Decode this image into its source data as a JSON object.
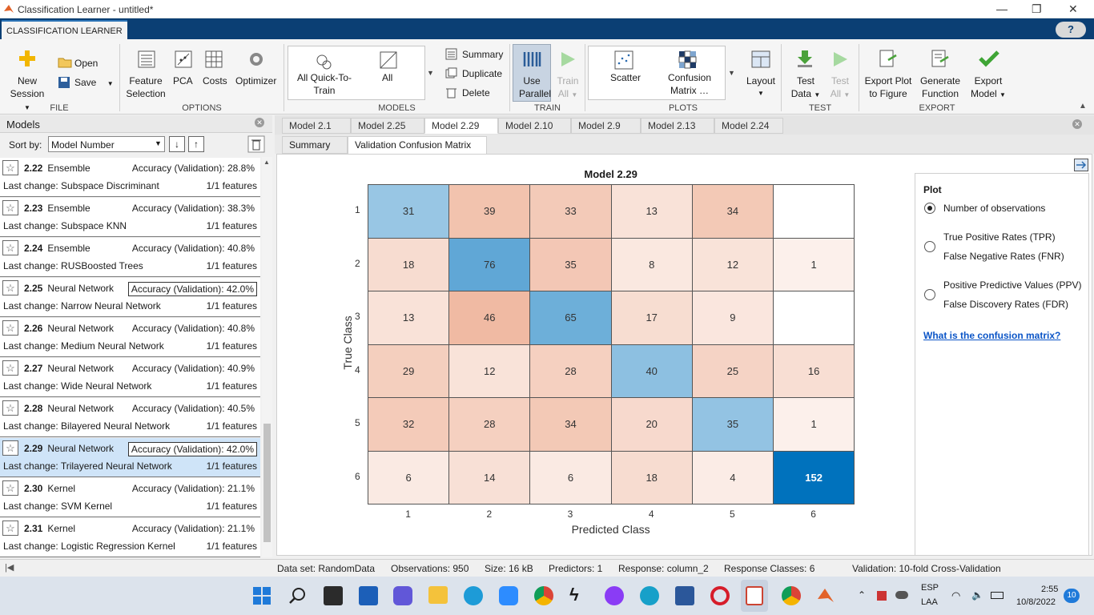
{
  "window": {
    "title": "Classification Learner - untitled*",
    "minimize": "—",
    "restore": "❐",
    "close": "✕"
  },
  "app_tab": "CLASSIFICATION LEARNER",
  "help": "?",
  "ribbon": {
    "file": {
      "new_session": [
        "New",
        "Session"
      ],
      "open": "Open",
      "save": "Save",
      "section": "FILE"
    },
    "options": {
      "feature_selection": [
        "Feature",
        "Selection"
      ],
      "pca": "PCA",
      "costs": "Costs",
      "optimizer": "Optimizer",
      "section": "OPTIONS"
    },
    "models": {
      "quick": [
        "All Quick-To-",
        "Train"
      ],
      "all": "All",
      "summary": "Summary",
      "duplicate": "Duplicate",
      "delete": "Delete",
      "section": "MODELS"
    },
    "train": {
      "use_parallel": [
        "Use",
        "Parallel"
      ],
      "train_all": [
        "Train",
        "All"
      ],
      "section": "TRAIN"
    },
    "plots": {
      "scatter": "Scatter",
      "confusion": [
        "Confusion",
        "Matrix"
      ],
      "layout": "Layout",
      "section": "PLOTS"
    },
    "test": {
      "test_data": [
        "Test",
        "Data"
      ],
      "test_all": [
        "Test",
        "All"
      ],
      "section": "TEST"
    },
    "export": {
      "export_plot": [
        "Export Plot",
        "to Figure"
      ],
      "generate_function": [
        "Generate",
        "Function"
      ],
      "export_model": [
        "Export",
        "Model"
      ],
      "section": "EXPORT"
    }
  },
  "models_panel": {
    "title": "Models",
    "sort_label": "Sort by:",
    "sort_value": "Model Number",
    "items": [
      {
        "id": "2.22",
        "type": "Ensemble",
        "acc": "Accuracy (Validation): 28.8%",
        "change": "Last change: Subspace Discriminant",
        "features": "1/1 features",
        "boxed": false,
        "selected": false
      },
      {
        "id": "2.23",
        "type": "Ensemble",
        "acc": "Accuracy (Validation): 38.3%",
        "change": "Last change: Subspace KNN",
        "features": "1/1 features",
        "boxed": false,
        "selected": false
      },
      {
        "id": "2.24",
        "type": "Ensemble",
        "acc": "Accuracy (Validation): 40.8%",
        "change": "Last change: RUSBoosted Trees",
        "features": "1/1 features",
        "boxed": false,
        "selected": false
      },
      {
        "id": "2.25",
        "type": "Neural Network",
        "acc": "Accuracy (Validation): 42.0%",
        "change": "Last change: Narrow Neural Network",
        "features": "1/1 features",
        "boxed": true,
        "selected": false
      },
      {
        "id": "2.26",
        "type": "Neural Network",
        "acc": "Accuracy (Validation): 40.8%",
        "change": "Last change: Medium Neural Network",
        "features": "1/1 features",
        "boxed": false,
        "selected": false
      },
      {
        "id": "2.27",
        "type": "Neural Network",
        "acc": "Accuracy (Validation): 40.9%",
        "change": "Last change: Wide Neural Network",
        "features": "1/1 features",
        "boxed": false,
        "selected": false
      },
      {
        "id": "2.28",
        "type": "Neural Network",
        "acc": "Accuracy (Validation): 40.5%",
        "change": "Last change: Bilayered Neural Network",
        "features": "1/1 features",
        "boxed": false,
        "selected": false
      },
      {
        "id": "2.29",
        "type": "Neural Network",
        "acc": "Accuracy (Validation): 42.0%",
        "change": "Last change: Trilayered Neural Network",
        "features": "1/1 features",
        "boxed": true,
        "selected": true
      },
      {
        "id": "2.30",
        "type": "Kernel",
        "acc": "Accuracy (Validation): 21.1%",
        "change": "Last change: SVM Kernel",
        "features": "1/1 features",
        "boxed": false,
        "selected": false
      },
      {
        "id": "2.31",
        "type": "Kernel",
        "acc": "Accuracy (Validation): 21.1%",
        "change": "Last change: Logistic Regression Kernel",
        "features": "1/1 features",
        "boxed": false,
        "selected": false
      }
    ]
  },
  "doc_tabs": [
    "Model 2.1",
    "Model 2.25",
    "Model 2.29",
    "Model 2.10",
    "Model 2.9",
    "Model 2.13",
    "Model 2.24"
  ],
  "active_doc_tab": "Model 2.29",
  "sub_tabs": [
    "Summary",
    "Validation Confusion Matrix"
  ],
  "chart_data": {
    "type": "heatmap",
    "title": "Model 2.29",
    "xlabel": "Predicted Class",
    "ylabel": "True Class",
    "x_ticks": [
      "1",
      "2",
      "3",
      "4",
      "5",
      "6"
    ],
    "y_ticks": [
      "1",
      "2",
      "3",
      "4",
      "5",
      "6"
    ],
    "matrix": [
      [
        31,
        39,
        33,
        13,
        34,
        null
      ],
      [
        18,
        76,
        35,
        8,
        12,
        1
      ],
      [
        13,
        46,
        65,
        17,
        9,
        null
      ],
      [
        29,
        12,
        28,
        40,
        25,
        16
      ],
      [
        32,
        28,
        34,
        20,
        35,
        1
      ],
      [
        6,
        14,
        6,
        18,
        4,
        152
      ]
    ],
    "colors": {
      "diag_base": "#0072bd",
      "offdiag_base": "#d95319"
    }
  },
  "plot_panel": {
    "title": "Plot",
    "options": [
      {
        "lines": [
          "Number of observations"
        ],
        "selected": true
      },
      {
        "lines": [
          "True Positive Rates (TPR)",
          "False Negative Rates (FNR)"
        ],
        "selected": false
      },
      {
        "lines": [
          "Positive Predictive Values (PPV)",
          "False Discovery Rates (FDR)"
        ],
        "selected": false
      }
    ],
    "help_link": "What is the confusion matrix?"
  },
  "status": {
    "dataset": "Data set: RandomData",
    "observations": "Observations: 950",
    "size": "Size: 16 kB",
    "predictors": "Predictors: 1",
    "response": "Response: column_2",
    "classes": "Response Classes: 6",
    "validation": "Validation: 10-fold Cross-Validation"
  },
  "taskbar": {
    "lang": "ESP",
    "lang2": "LAA",
    "time": "2:55",
    "date": "10/8/2022",
    "badge": "10"
  }
}
